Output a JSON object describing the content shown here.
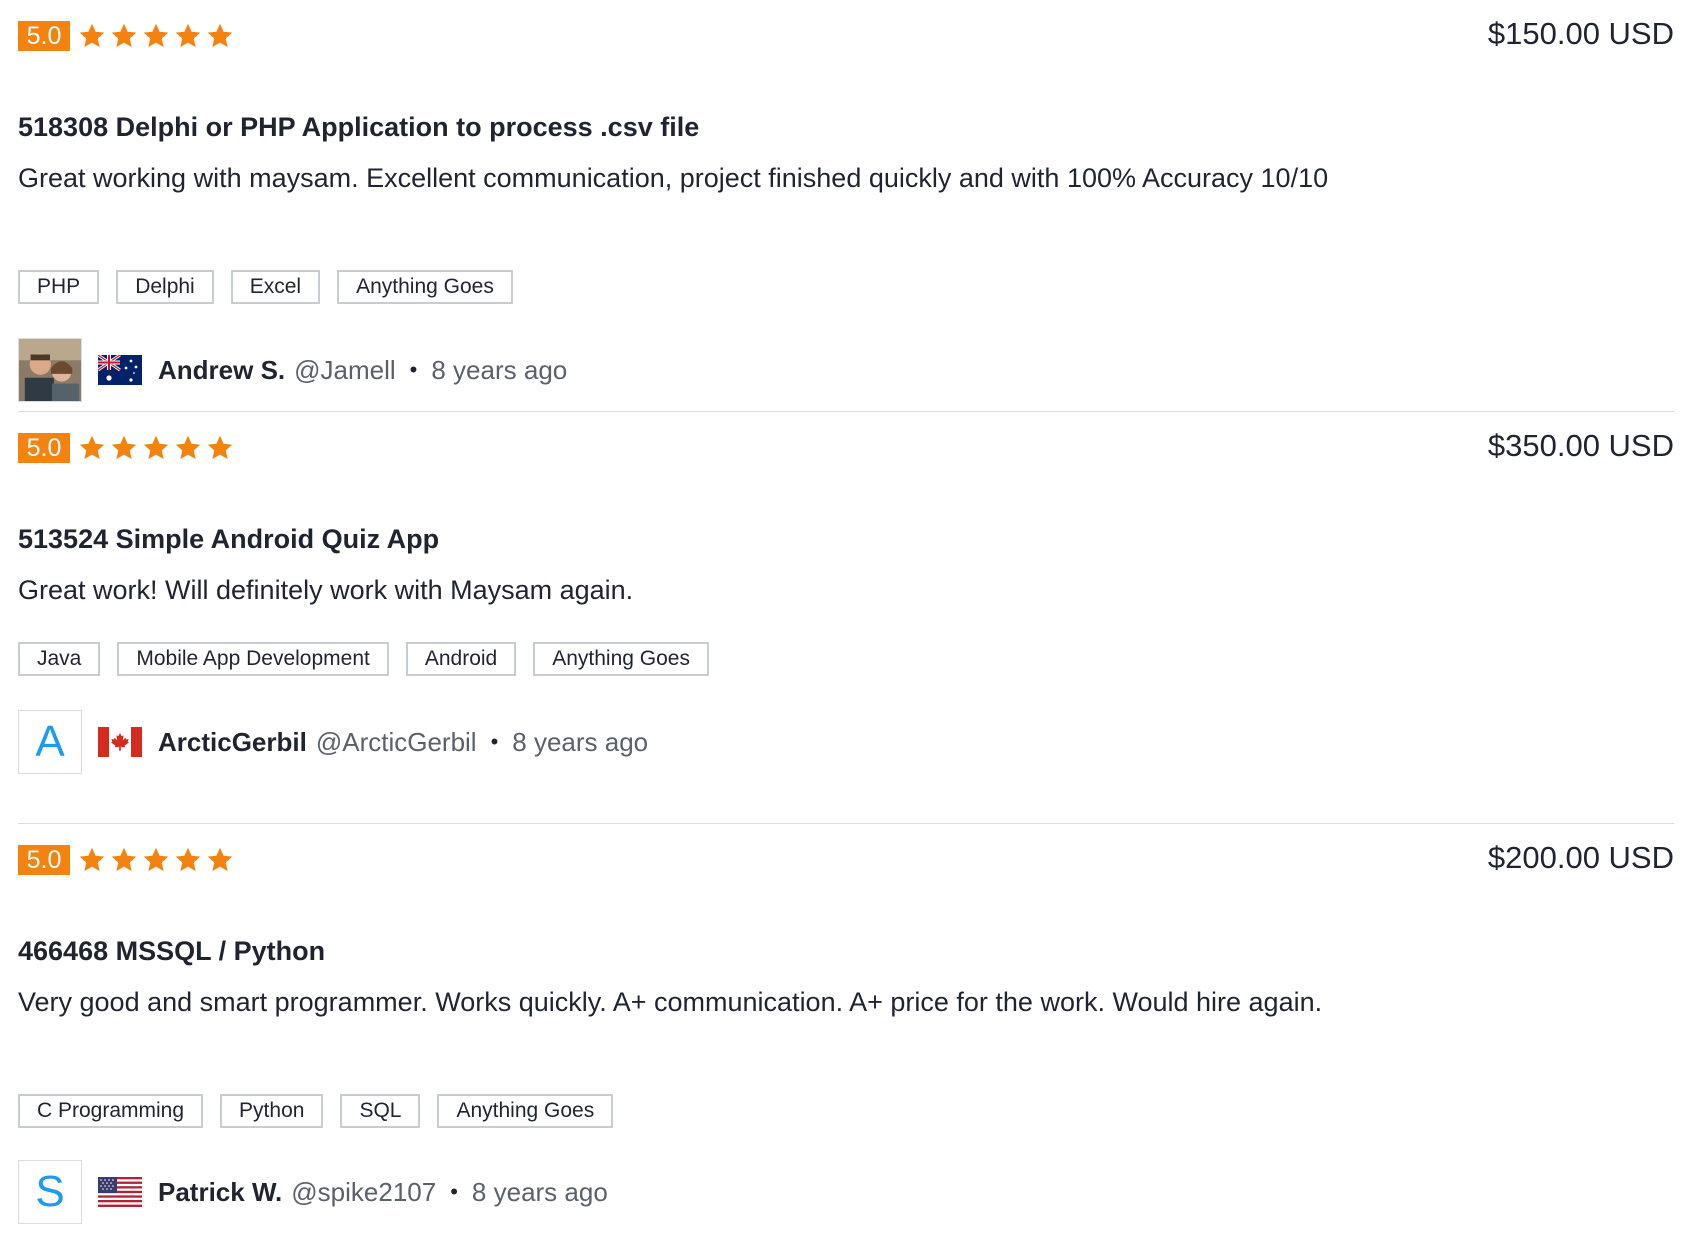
{
  "accent_color": "#f4820f",
  "reviews": [
    {
      "rating": "5.0",
      "stars": 5,
      "price": "$150.00 USD",
      "title": "518308 Delphi or PHP Application to process .csv file",
      "comment": "Great working with maysam. Excellent communication, project finished quickly and with 100% Accuracy 10/10",
      "tags": [
        "PHP",
        "Delphi",
        "Excel",
        "Anything Goes"
      ],
      "reviewer": {
        "name": "Andrew S.",
        "handle": "@Jamell",
        "time": "8 years ago",
        "country_flag": "australia-flag-icon",
        "avatar_type": "photo",
        "avatar_letter": ""
      }
    },
    {
      "rating": "5.0",
      "stars": 5,
      "price": "$350.00 USD",
      "title": "513524 Simple Android Quiz App",
      "comment": "Great work! Will definitely work with Maysam again.",
      "tags": [
        "Java",
        "Mobile App Development",
        "Android",
        "Anything Goes"
      ],
      "reviewer": {
        "name": "ArcticGerbil",
        "handle": "@ArcticGerbil",
        "time": "8 years ago",
        "country_flag": "canada-flag-icon",
        "avatar_type": "letter",
        "avatar_letter": "A"
      }
    },
    {
      "rating": "5.0",
      "stars": 5,
      "price": "$200.00 USD",
      "title": "466468 MSSQL / Python",
      "comment": "Very good and smart programmer. Works quickly. A+ communication. A+ price for the work. Would hire again.",
      "tags": [
        "C Programming",
        "Python",
        "SQL",
        "Anything Goes"
      ],
      "reviewer": {
        "name": "Patrick W.",
        "handle": "@spike2107",
        "time": "8 years ago",
        "country_flag": "usa-flag-icon",
        "avatar_type": "letter",
        "avatar_letter": "S"
      }
    }
  ]
}
